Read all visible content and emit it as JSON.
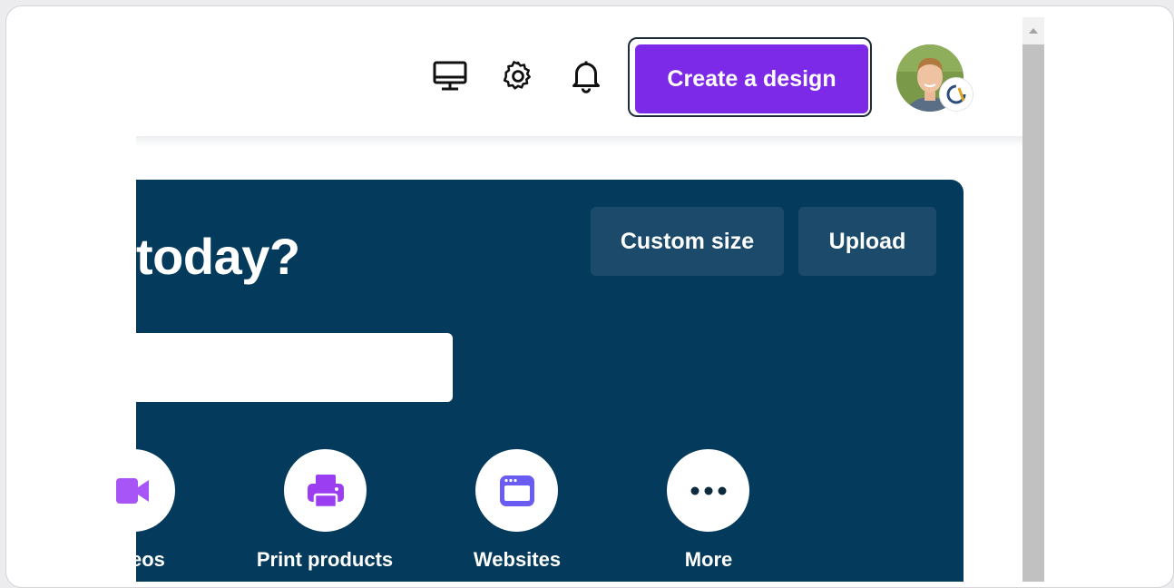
{
  "header": {
    "create_label": "Create a design",
    "icons": [
      "desktop-icon",
      "gear-icon",
      "bell-icon"
    ]
  },
  "banner": {
    "headline": "today?",
    "custom_size_label": "Custom size",
    "upload_label": "Upload",
    "search_value": "",
    "categories": [
      {
        "label": "eos",
        "icon": "video-icon",
        "color": "#a855f7"
      },
      {
        "label": "Print products",
        "icon": "printer-icon",
        "color": "#9b3df0"
      },
      {
        "label": "Websites",
        "icon": "browser-window-icon",
        "color": "#6a5cf2"
      },
      {
        "label": "More",
        "icon": "more-dots-icon",
        "color": "#0e2a3d"
      }
    ]
  },
  "colors": {
    "accent": "#7d2ae8",
    "banner": "#043a5b",
    "chip": "#1b4a6a"
  }
}
